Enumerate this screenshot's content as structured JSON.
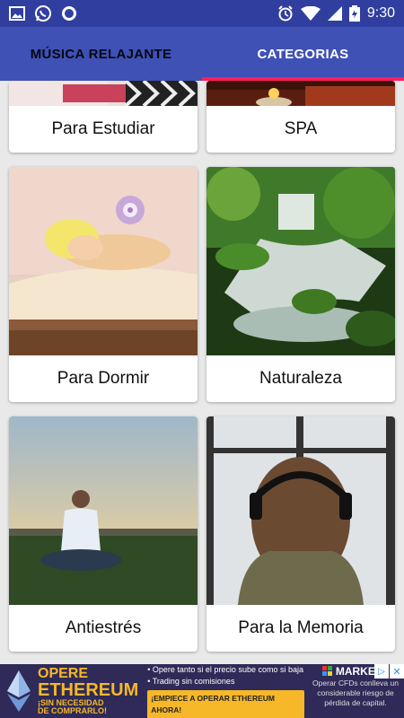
{
  "status_bar": {
    "time": "9:30"
  },
  "tabs": [
    {
      "label": "MÚSICA RELAJANTE",
      "active": false
    },
    {
      "label": "CATEGORIAS",
      "active": true
    }
  ],
  "categories": [
    {
      "label": "Para Estudiar",
      "image": "study-photo"
    },
    {
      "label": "SPA",
      "image": "spa-candle-photo"
    },
    {
      "label": "Para Dormir",
      "image": "sleeping-baby-photo"
    },
    {
      "label": "Naturaleza",
      "image": "waterfall-forest-photo"
    },
    {
      "label": "Antiestrés",
      "image": "meditation-sunset-photo"
    },
    {
      "label": "Para la Memoria",
      "image": "woman-headphones-window-photo"
    }
  ],
  "ad": {
    "line1": "OPERE",
    "line2": "ETHEREUM",
    "line3": "¡SIN NECESIDAD",
    "line4": "DE COMPRARLO!",
    "bullet1": "Opere tanto si el precio sube como si baja",
    "bullet2": "Trading sin comisiones",
    "cta": "¡EMPIECE A OPERAR ETHEREUM AHORA!",
    "brand": "MARKETS",
    "disclaimer": "Operar CFDs conlleva un considerable riesgo de pérdida de capital.",
    "colors": {
      "background": "#2f2a57",
      "accent": "#f6b829"
    }
  },
  "colors": {
    "primary": "#3f51b5",
    "primary_dark": "#303f9f",
    "tab_indicator": "#ff1f5a"
  }
}
